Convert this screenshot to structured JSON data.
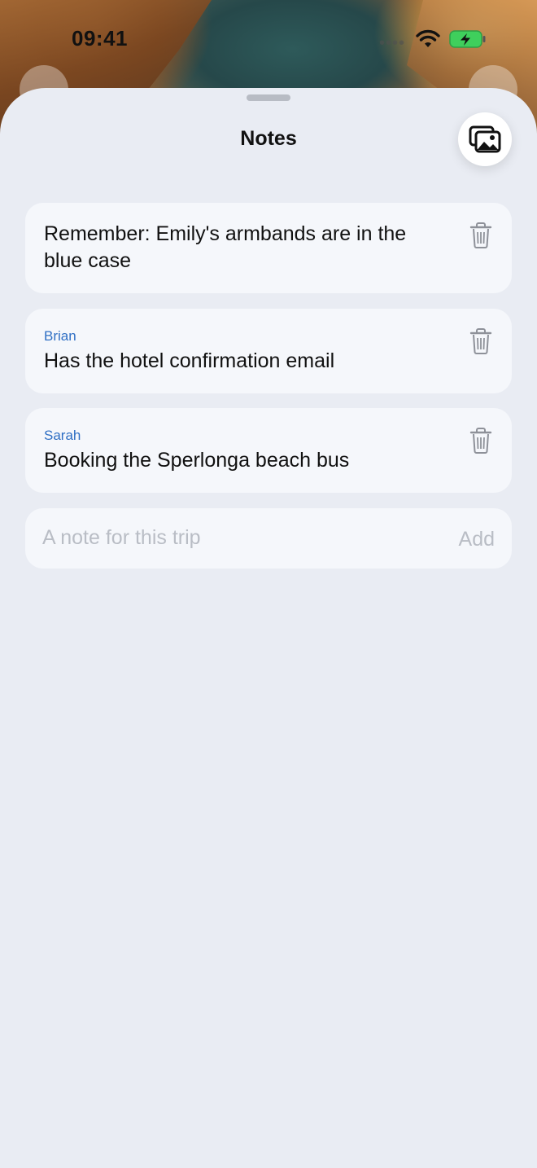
{
  "status_bar": {
    "time": "09:41"
  },
  "sheet": {
    "title": "Notes"
  },
  "notes": [
    {
      "author": "",
      "text": "Remember: Emily's armbands are in the blue case"
    },
    {
      "author": "Brian",
      "text": "Has the hotel confirmation email"
    },
    {
      "author": "Sarah",
      "text": "Booking the Sperlonga beach bus"
    }
  ],
  "composer": {
    "placeholder": "A note for this trip",
    "add_label": "Add"
  },
  "colors": {
    "author": "#2f6fc4",
    "background": "#e9ecf3",
    "card": "#f5f7fb"
  }
}
